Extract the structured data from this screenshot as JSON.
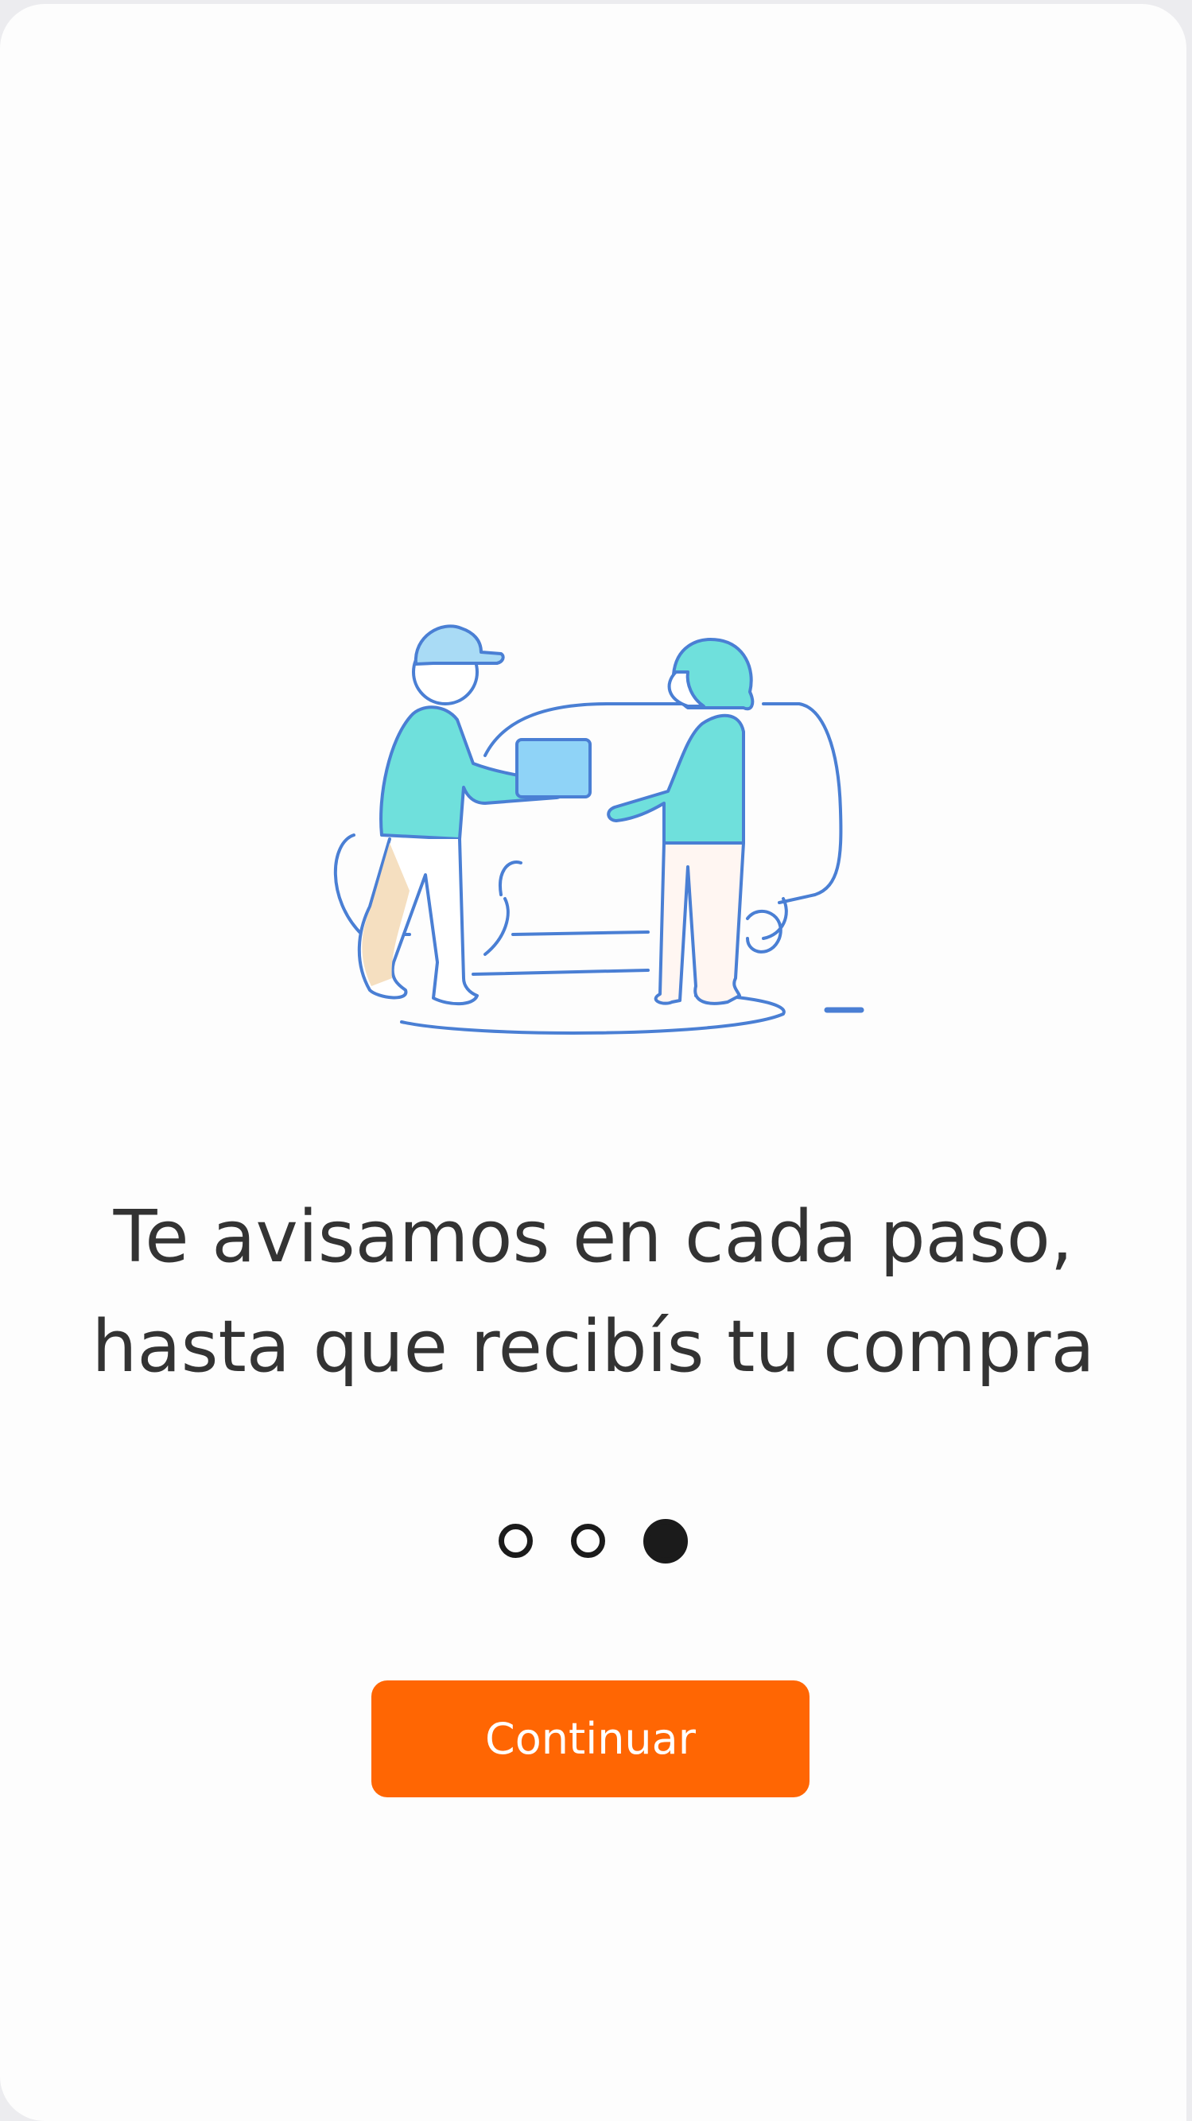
{
  "onboarding": {
    "headline_line1": "Te avisamos en cada paso,",
    "headline_line2": "hasta que recibís tu compra",
    "illustration_icon": "delivery-handoff-illustration",
    "pager": {
      "total_pages": 3,
      "current_page": 3
    },
    "continue_label": "Continuar"
  },
  "colors": {
    "accent": "#ff6603",
    "text": "#333333",
    "dot": "#1b1b1b",
    "illustration_line": "#4a7fd4",
    "illustration_fill": "#6fe0dc"
  }
}
